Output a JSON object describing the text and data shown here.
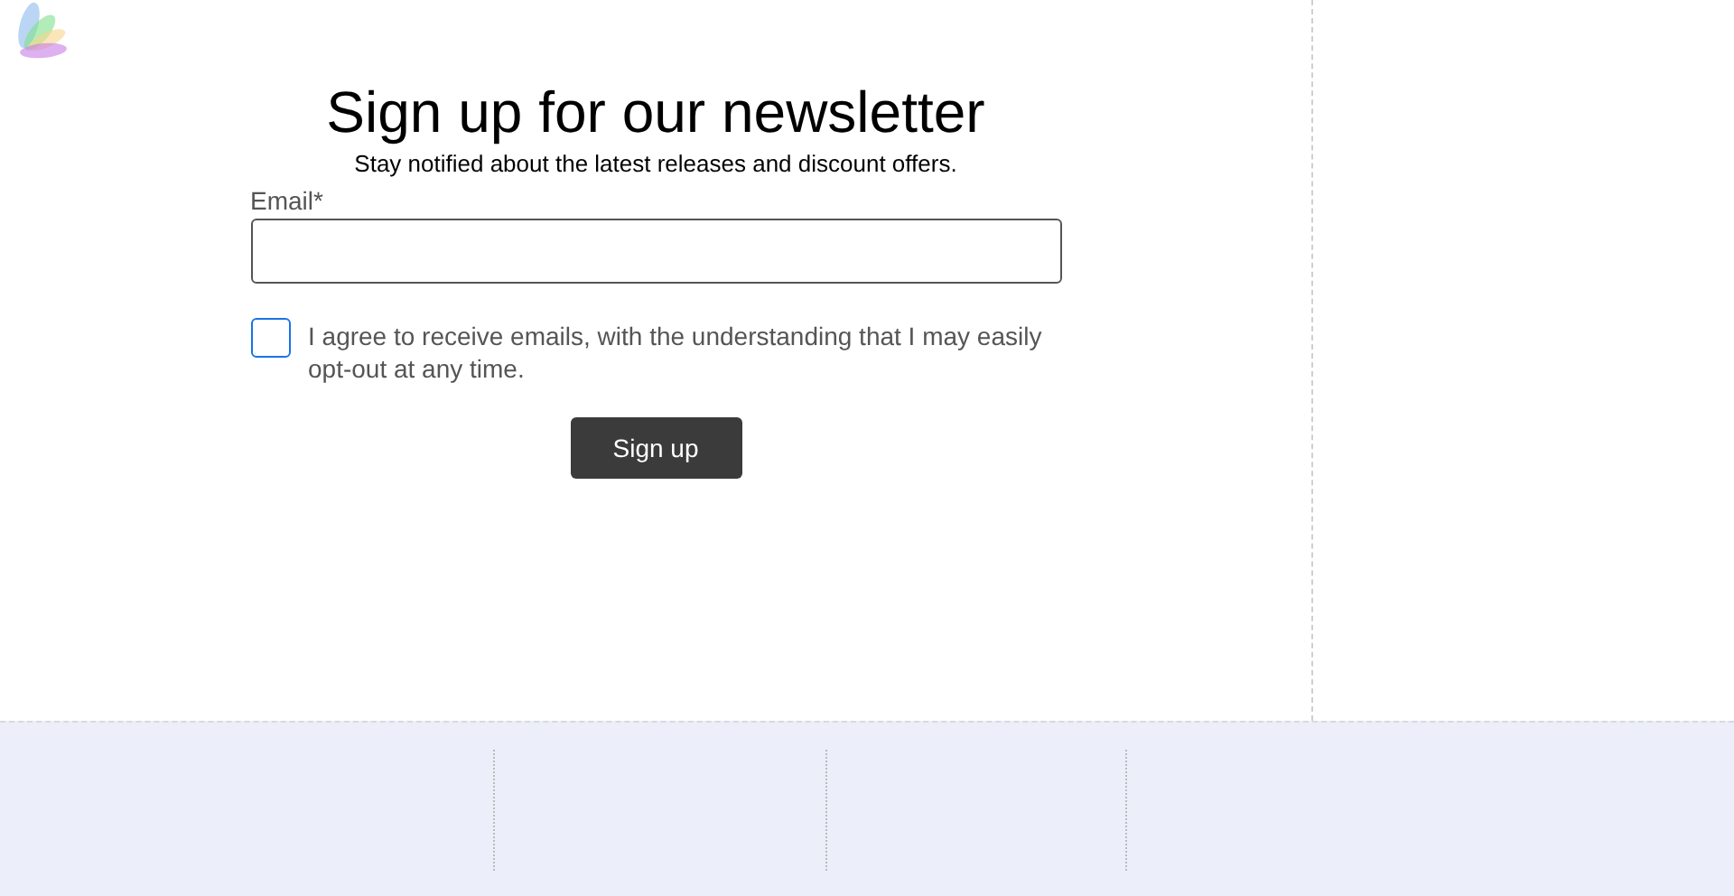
{
  "heading": "Sign up for our newsletter",
  "subtitle": "Stay notified about the latest releases and discount offers.",
  "email_field": {
    "label": "Email*"
  },
  "consent": {
    "label": "I agree to receive emails, with the understanding that I may easily opt-out at any time.",
    "checked": false
  },
  "submit_button": "Sign up"
}
